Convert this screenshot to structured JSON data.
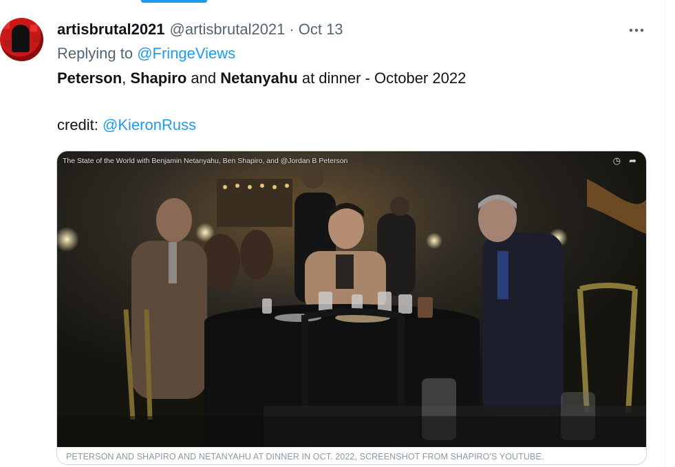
{
  "tweet": {
    "author_name": "artisbrutal2021",
    "author_handle": "@artisbrutal2021",
    "separator": "·",
    "date": "Oct 13",
    "more_icon": "more-horizontal-icon",
    "reply_prefix": "Replying to",
    "reply_to": "@FringeViews",
    "text": {
      "w1": "Peterson",
      "c1": ", ",
      "w2": "Shapiro",
      "c2": " and ",
      "w3": "Netanyahu",
      "c3": " at dinner - October 2022"
    },
    "credit_prefix": "credit:",
    "credit_handle": "@KieronRuss"
  },
  "media": {
    "video_title": "The State of the World with Benjamin Netanyahu, Ben Shapiro, and @Jordan B Peterson",
    "caption": "PETERSON AND SHAPIRO AND NETANYAHU AT DINNER IN OCT. 2022, SCREENSHOT FROM SHAPIRO'S YOUTUBE."
  },
  "colors": {
    "link": "#1d9bf0",
    "secondary_text": "#536471",
    "border": "#cfd9de"
  }
}
